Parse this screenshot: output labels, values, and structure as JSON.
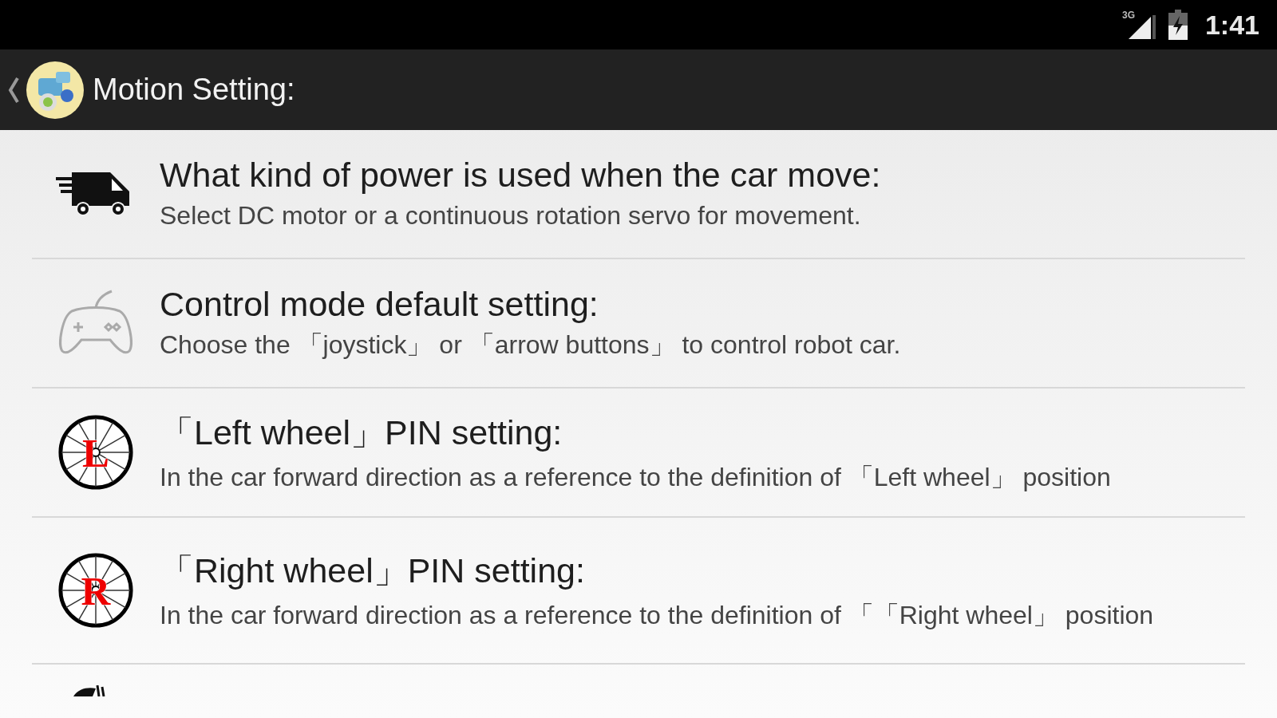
{
  "status_bar": {
    "network": "3G",
    "time": "1:41"
  },
  "action_bar": {
    "title": "Motion Setting:"
  },
  "items": [
    {
      "kind": "truck",
      "title": "What kind of power is used when the car move:",
      "subtitle": "Select DC motor or a continuous rotation servo for movement."
    },
    {
      "kind": "gamepad",
      "title": "Control mode default setting:",
      "subtitle": "Choose the 「joystick」 or 「arrow buttons」 to control robot car."
    },
    {
      "kind": "wheel",
      "letter": "L",
      "title": "「Left wheel」PIN setting:",
      "subtitle": "In the car forward direction as a reference to the definition of 「Left wheel」 position"
    },
    {
      "kind": "wheel",
      "letter": "R",
      "title": "「Right wheel」PIN setting:",
      "subtitle": "In the car forward direction as a reference to the definition of 「「Right wheel」 position"
    },
    {
      "kind": "gauge"
    }
  ]
}
